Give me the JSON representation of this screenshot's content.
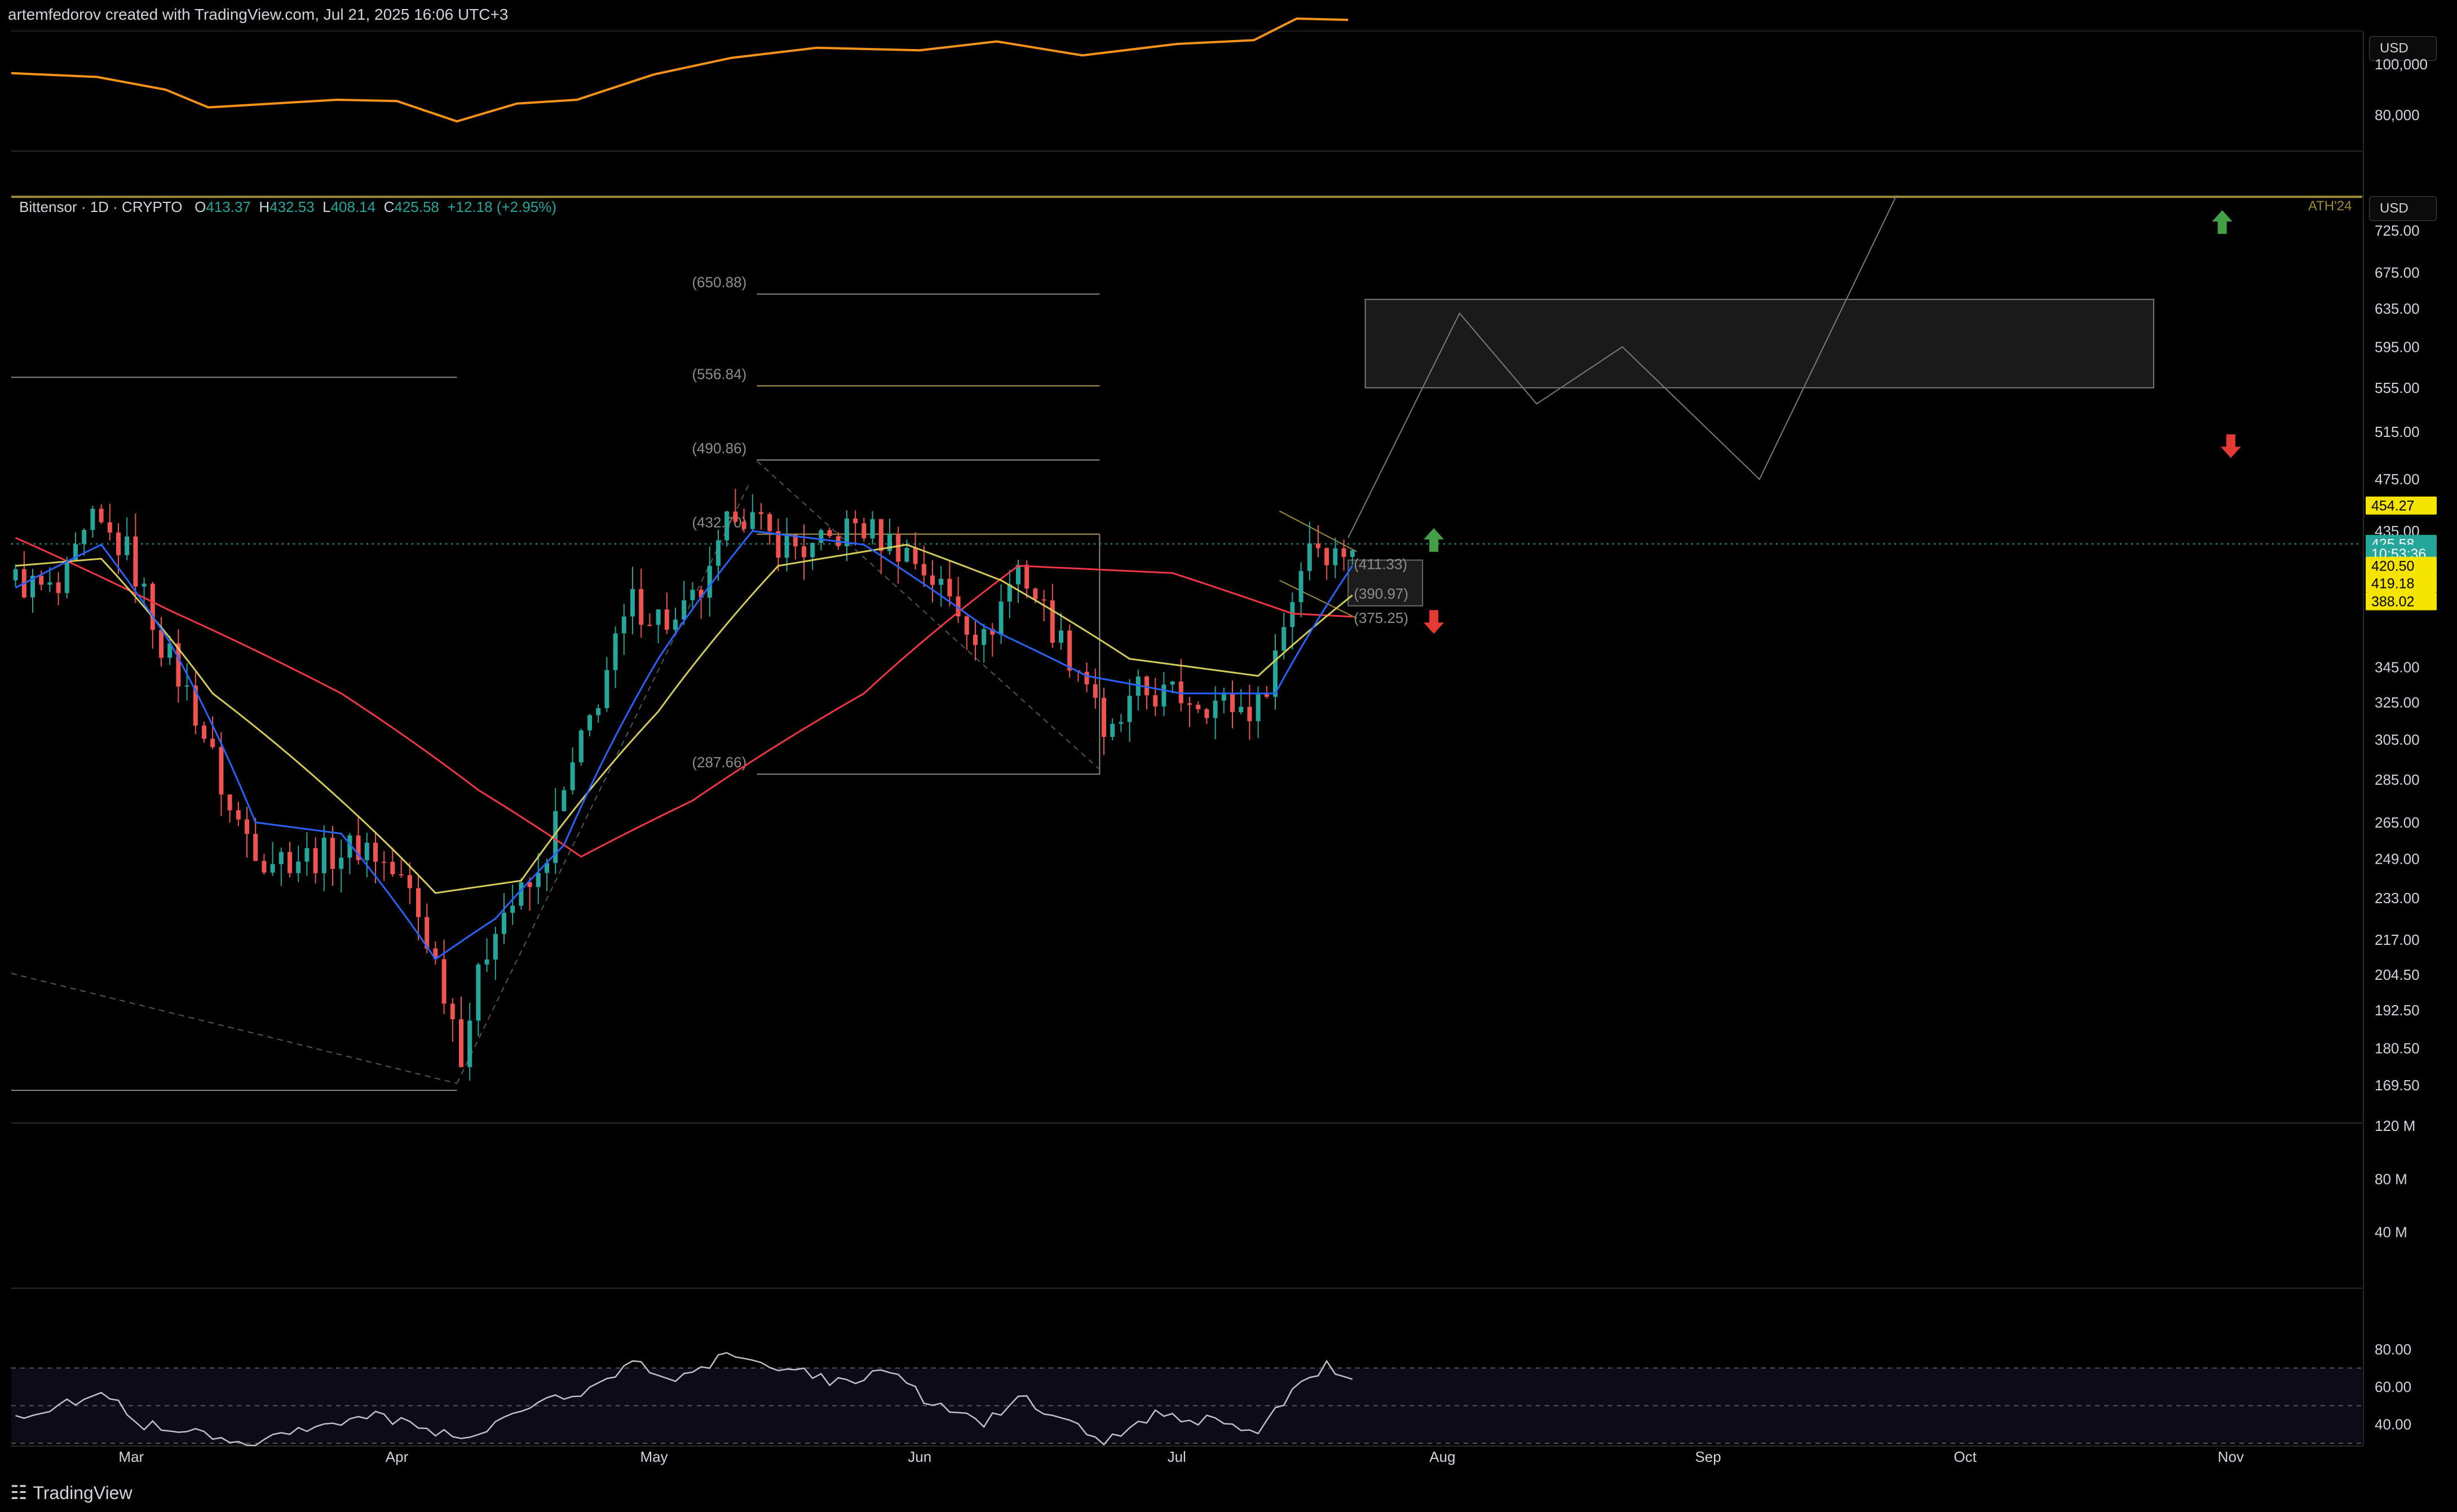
{
  "header": {
    "attribution": "artemfedorov created with TradingView.com, Jul 21, 2025 16:06 UTC+3"
  },
  "footer": {
    "brand": "TradingView",
    "logo": "tradingview-logo-icon"
  },
  "legend": {
    "symbol": "Bittensor · 1D · CRYPTO",
    "o_label": "O",
    "o": "413.37",
    "h_label": "H",
    "h": "432.53",
    "l_label": "L",
    "l": "408.14",
    "c_label": "C",
    "c": "425.58",
    "change": "+12.18 (+2.95%)"
  },
  "currency_buttons": [
    "USD",
    "USD"
  ],
  "ath_label": "ATH'24",
  "colors": {
    "background": "#000000",
    "up": "#26a69a",
    "down": "#ef5350",
    "ma_fast": "#2962ff",
    "ma_mid": "#d4cc5a",
    "ma_slow": "#f23645",
    "btc_line": "#f7931a",
    "ath_line": "#9b8a3a",
    "rsi": "#c0c0c8",
    "label_green": "#26a69a",
    "label_yellow": "#f5e400"
  },
  "chart_data": [
    {
      "type": "line",
      "name_id": "btc-comparison",
      "x": [
        "2025-02-15",
        "2025-02-25",
        "2025-03-05",
        "2025-03-10",
        "2025-03-15",
        "2025-03-25",
        "2025-04-01",
        "2025-04-08",
        "2025-04-15",
        "2025-04-22",
        "2025-05-01",
        "2025-05-10",
        "2025-05-20",
        "2025-06-01",
        "2025-06-10",
        "2025-06-20",
        "2025-07-01",
        "2025-07-10",
        "2025-07-15",
        "2025-07-21"
      ],
      "values": [
        96500,
        95000,
        90000,
        83000,
        84000,
        86000,
        85500,
        77500,
        84500,
        86000,
        96000,
        102500,
        106500,
        105500,
        109000,
        103500,
        108000,
        109500,
        118000,
        117500
      ],
      "ylim": [
        72000,
        112000
      ],
      "ticks": [
        100000,
        80000
      ],
      "tick_labels": [
        "100,000",
        "80,000"
      ],
      "unit": "USD"
    },
    {
      "type": "candlestick",
      "name_id": "bittensor-price",
      "start_date": "2025-02-15",
      "y_scale": "log",
      "y_range": [
        160,
        760
      ],
      "y_ticks": [
        725,
        675,
        635,
        595,
        555,
        515,
        475,
        435,
        345,
        325,
        305,
        285,
        265,
        249,
        233,
        217,
        204.5,
        192.5,
        180.5,
        169.5
      ],
      "y_tick_labels": [
        "725.00",
        "675.00",
        "635.00",
        "595.00",
        "555.00",
        "515.00",
        "475.00",
        "435.00",
        "345.00",
        "325.00",
        "305.00",
        "285.00",
        "265.00",
        "249.00",
        "233.00",
        "217.00",
        "204.50",
        "192.50",
        "180.50",
        "169.50"
      ],
      "x_ticks": [
        "2025-03-01",
        "2025-04-01",
        "2025-05-01",
        "2025-06-01",
        "2025-07-01",
        "2025-08-01",
        "2025-09-01",
        "2025-10-01",
        "2025-11-01"
      ],
      "x_tick_labels": [
        "Mar",
        "Apr",
        "May",
        "Jun",
        "Jul",
        "Aug",
        "Sep",
        "Oct",
        "Nov"
      ],
      "close_keypoints": [
        [
          "2025-02-15",
          400
        ],
        [
          "2025-02-20",
          390
        ],
        [
          "2025-02-24",
          440
        ],
        [
          "2025-02-28",
          420
        ],
        [
          "2025-03-04",
          360
        ],
        [
          "2025-03-08",
          320
        ],
        [
          "2025-03-12",
          270
        ],
        [
          "2025-03-16",
          250
        ],
        [
          "2025-03-22",
          250
        ],
        [
          "2025-03-28",
          255
        ],
        [
          "2025-04-02",
          235
        ],
        [
          "2025-04-06",
          200
        ],
        [
          "2025-04-08",
          180
        ],
        [
          "2025-04-12",
          225
        ],
        [
          "2025-04-17",
          240
        ],
        [
          "2025-04-23",
          315
        ],
        [
          "2025-04-28",
          385
        ],
        [
          "2025-05-03",
          370
        ],
        [
          "2025-05-07",
          400
        ],
        [
          "2025-05-10",
          455
        ],
        [
          "2025-05-14",
          430
        ],
        [
          "2025-05-19",
          420
        ],
        [
          "2025-05-24",
          440
        ],
        [
          "2025-05-30",
          420
        ],
        [
          "2025-06-03",
          395
        ],
        [
          "2025-06-08",
          360
        ],
        [
          "2025-06-12",
          410
        ],
        [
          "2025-06-17",
          360
        ],
        [
          "2025-06-21",
          330
        ],
        [
          "2025-06-22",
          300
        ],
        [
          "2025-06-26",
          330
        ],
        [
          "2025-07-02",
          328
        ],
        [
          "2025-07-08",
          322
        ],
        [
          "2025-07-10",
          322
        ],
        [
          "2025-07-13",
          370
        ],
        [
          "2025-07-16",
          430
        ],
        [
          "2025-07-19",
          418
        ],
        [
          "2025-07-21",
          425.58
        ]
      ],
      "ma_fast_keypoints": [
        [
          "2025-02-15",
          395
        ],
        [
          "2025-02-25",
          425
        ],
        [
          "2025-03-05",
          360
        ],
        [
          "2025-03-15",
          265
        ],
        [
          "2025-03-25",
          260
        ],
        [
          "2025-04-05",
          210
        ],
        [
          "2025-04-12",
          225
        ],
        [
          "2025-04-20",
          255
        ],
        [
          "2025-05-01",
          350
        ],
        [
          "2025-05-12",
          435
        ],
        [
          "2025-05-25",
          425
        ],
        [
          "2025-06-08",
          370
        ],
        [
          "2025-06-20",
          340
        ],
        [
          "2025-07-01",
          330
        ],
        [
          "2025-07-12",
          330
        ],
        [
          "2025-07-21",
          410
        ]
      ],
      "ma_mid_keypoints": [
        [
          "2025-02-15",
          410
        ],
        [
          "2025-02-25",
          415
        ],
        [
          "2025-03-10",
          330
        ],
        [
          "2025-03-25",
          275
        ],
        [
          "2025-04-05",
          235
        ],
        [
          "2025-04-15",
          240
        ],
        [
          "2025-05-01",
          320
        ],
        [
          "2025-05-15",
          410
        ],
        [
          "2025-05-30",
          425
        ],
        [
          "2025-06-10",
          400
        ],
        [
          "2025-06-25",
          350
        ],
        [
          "2025-07-10",
          340
        ],
        [
          "2025-07-21",
          390
        ]
      ],
      "ma_slow_keypoints": [
        [
          "2025-02-15",
          430
        ],
        [
          "2025-03-05",
          380
        ],
        [
          "2025-03-25",
          330
        ],
        [
          "2025-04-10",
          280
        ],
        [
          "2025-04-22",
          250
        ],
        [
          "2025-05-05",
          275
        ],
        [
          "2025-05-25",
          330
        ],
        [
          "2025-06-12",
          410
        ],
        [
          "2025-06-30",
          405
        ],
        [
          "2025-07-14",
          378
        ],
        [
          "2025-07-21",
          376
        ]
      ],
      "fib_levels": [
        {
          "label": "(650.88)",
          "value": 650.88
        },
        {
          "label": "(556.84)",
          "value": 556.84
        },
        {
          "label": "(490.86)",
          "value": 490.86
        },
        {
          "label": "(432.70)",
          "value": 432.7
        },
        {
          "label": "(287.66)",
          "value": 287.66
        }
      ],
      "short_term_levels": [
        {
          "label": "(411.33)",
          "value": 411.33
        },
        {
          "label": "(390.97)",
          "value": 390.97
        },
        {
          "label": "(375.25)",
          "value": 375.25
        }
      ],
      "ath_level": 765,
      "horizontal_lines": [
        {
          "value": 565,
          "from": "2025-02-15",
          "to": "2025-04-08"
        },
        {
          "value": 168,
          "from": "2025-02-15",
          "to": "2025-04-08"
        }
      ],
      "target_zone": {
        "from": "2025-07-23",
        "to": "2025-10-23",
        "low": 555,
        "high": 645
      },
      "projection_path": [
        [
          "2025-07-21",
          430
        ],
        [
          "2025-08-03",
          630
        ],
        [
          "2025-08-12",
          540
        ],
        [
          "2025-08-22",
          595
        ],
        [
          "2025-09-07",
          475
        ],
        [
          "2025-09-23",
          770
        ]
      ],
      "price_labels": [
        {
          "text": "454.27",
          "value": 454.27,
          "style": "yellow"
        },
        {
          "text": "425.58",
          "value": 425.58,
          "style": "green"
        },
        {
          "text": "10:53:36",
          "value": 418.5,
          "style": "green-sub"
        },
        {
          "text": "420.50",
          "value": 410,
          "style": "yellow"
        },
        {
          "text": "419.18",
          "value": 398,
          "style": "yellow"
        },
        {
          "text": "388.02",
          "value": 386,
          "style": "yellow"
        }
      ],
      "arrows": [
        {
          "dir": "up",
          "date": "2025-07-31",
          "value": 428
        },
        {
          "dir": "down",
          "date": "2025-07-31",
          "value": 373
        },
        {
          "dir": "up",
          "date": "2025-10-31",
          "value": 735
        },
        {
          "dir": "down",
          "date": "2025-11-01",
          "value": 503
        }
      ]
    },
    {
      "type": "bar",
      "name_id": "volume",
      "y_ticks": [
        120,
        80,
        40
      ],
      "y_tick_labels": [
        "120 M",
        "80 M",
        "40 M"
      ],
      "unit": "M"
    },
    {
      "type": "line",
      "name_id": "rsi",
      "ylim": [
        30,
        90
      ],
      "y_ticks": [
        80,
        60,
        40
      ],
      "y_tick_labels": [
        "80.00",
        "60.00",
        "40.00"
      ],
      "band": [
        30,
        70
      ],
      "keypoints": [
        [
          "2025-02-15",
          45
        ],
        [
          "2025-02-22",
          52
        ],
        [
          "2025-02-25",
          58
        ],
        [
          "2025-03-02",
          40
        ],
        [
          "2025-03-10",
          35
        ],
        [
          "2025-03-15",
          30
        ],
        [
          "2025-03-22",
          40
        ],
        [
          "2025-03-28",
          45
        ],
        [
          "2025-04-02",
          40
        ],
        [
          "2025-04-08",
          32
        ],
        [
          "2025-04-14",
          45
        ],
        [
          "2025-04-22",
          58
        ],
        [
          "2025-04-28",
          72
        ],
        [
          "2025-05-03",
          65
        ],
        [
          "2025-05-10",
          78
        ],
        [
          "2025-05-16",
          70
        ],
        [
          "2025-05-22",
          62
        ],
        [
          "2025-05-28",
          68
        ],
        [
          "2025-06-02",
          50
        ],
        [
          "2025-06-08",
          40
        ],
        [
          "2025-06-12",
          55
        ],
        [
          "2025-06-18",
          42
        ],
        [
          "2025-06-22",
          30
        ],
        [
          "2025-06-28",
          45
        ],
        [
          "2025-07-04",
          42
        ],
        [
          "2025-07-10",
          38
        ],
        [
          "2025-07-15",
          62
        ],
        [
          "2025-07-18",
          72
        ],
        [
          "2025-07-21",
          65
        ]
      ]
    }
  ]
}
